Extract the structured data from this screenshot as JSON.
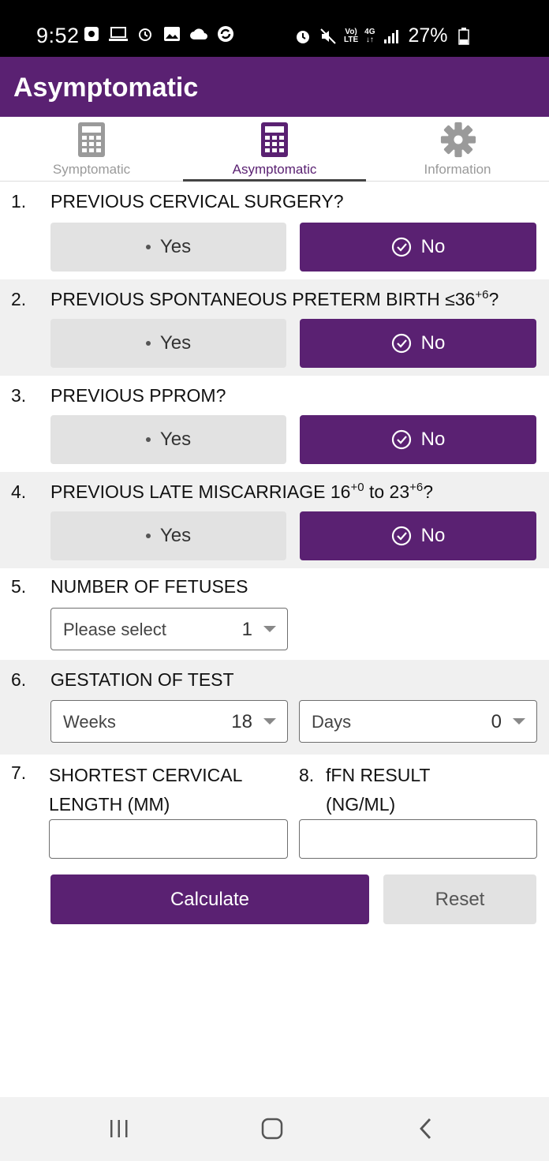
{
  "status_bar": {
    "time": "9:52",
    "battery": "27%",
    "network_top": "Vo)",
    "network_bottom": "LTE",
    "data_top": "4G",
    "data_bottom": "↓↑"
  },
  "app_bar": {
    "title": "Asymptomatic"
  },
  "tabs": [
    {
      "label": "Symptomatic",
      "icon": "calculator-icon",
      "active": false
    },
    {
      "label": "Asymptomatic",
      "icon": "calculator-icon",
      "active": true
    },
    {
      "label": "Information",
      "icon": "gear-icon",
      "active": false
    }
  ],
  "questions": [
    {
      "num": "1.",
      "text": "PREVIOUS CERVICAL SURGERY?",
      "yes_label": "Yes",
      "no_label": "No",
      "selected": "No"
    },
    {
      "num": "2.",
      "text_before": "PREVIOUS SPONTANEOUS PRETERM BIRTH ≤36",
      "text_sup": "+6",
      "text_after": "?",
      "yes_label": "Yes",
      "no_label": "No",
      "selected": "No"
    },
    {
      "num": "3.",
      "text": "PREVIOUS PPROM?",
      "yes_label": "Yes",
      "no_label": "No",
      "selected": "No"
    },
    {
      "num": "4.",
      "text_before": "PREVIOUS LATE MISCARRIAGE 16",
      "text_sup1": "+0",
      "text_mid": " to 23",
      "text_sup2": "+6",
      "text_after": "?",
      "yes_label": "Yes",
      "no_label": "No",
      "selected": "No"
    }
  ],
  "fetuses": {
    "num": "5.",
    "label": "NUMBER OF FETUSES",
    "placeholder": "Please select",
    "value": "1"
  },
  "gestation": {
    "num": "6.",
    "label": "GESTATION OF TEST",
    "weeks_placeholder": "Weeks",
    "weeks_value": "18",
    "days_placeholder": "Days",
    "days_value": "0"
  },
  "cervical_length": {
    "num": "7.",
    "label_line1": "SHORTEST CERVICAL",
    "label_line2": "LENGTH (MM)",
    "value": ""
  },
  "ffn": {
    "num": "8.",
    "label_line1": "fFN RESULT",
    "label_line2": "(NG/ML)",
    "value": ""
  },
  "actions": {
    "calculate_label": "Calculate",
    "reset_label": "Reset"
  },
  "colors": {
    "primary": "#5a2172",
    "button_grey": "#e2e2e2",
    "section_grey": "#f0f0f0"
  }
}
